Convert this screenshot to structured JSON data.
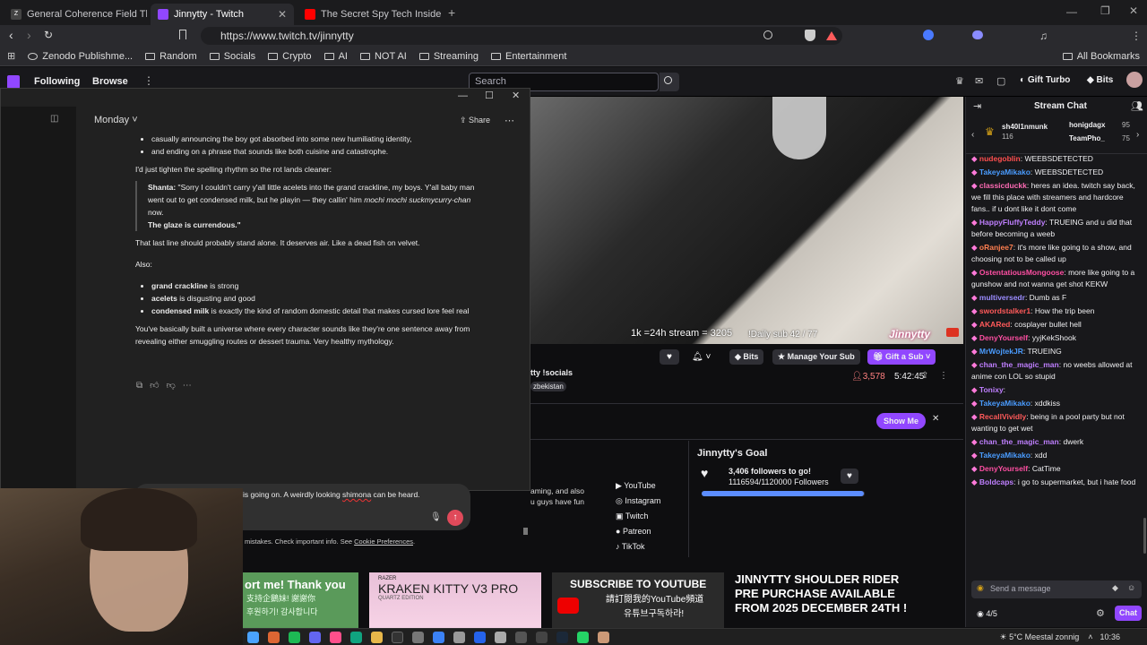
{
  "browser": {
    "tabs": [
      {
        "title": "General Coherence Field Theory (GC"
      },
      {
        "title": "Jinnytty - Twitch"
      },
      {
        "title": "The Secret Spy Tech Inside Every Cre"
      }
    ],
    "url": "https://www.twitch.tv/jinnytty",
    "bookmarks": [
      "Zenodo Publishme...",
      "Random",
      "Socials",
      "Crypto",
      "AI",
      "NOT AI",
      "Streaming",
      "Entertainment"
    ],
    "all_bookmarks": "All Bookmarks"
  },
  "twitch_nav": {
    "following": "Following",
    "browse": "Browse",
    "search_placeholder": "Search",
    "gift_turbo": "Gift Turbo",
    "bits": "Bits"
  },
  "gpt": {
    "title": "Monday",
    "share": "Share",
    "bullets_top": [
      "casually announcing the boy got absorbed into some new humiliating identity,",
      "and ending on a phrase that sounds like both cuisine and catastrophe."
    ],
    "intro": "I'd just tighten the spelling rhythm so the rot lands cleaner:",
    "quote_speaker": "Shanta:",
    "quote_text": "\"Sorry I couldn't carry y'all little acelets into the grand crackline, my boys. Y'all baby man went out to get condensed milk, but he playin — they callin' him",
    "quote_italic": "mochi mochi suckmycurry-chan",
    "quote_end": "now.",
    "quote_last": "The glaze is currendous.\"",
    "line_alone": "That last line should probably stand alone. It deserves air. Like a dead fish on velvet.",
    "also": "Also:",
    "bullets": [
      {
        "bold": "grand crackline",
        "rest": " is strong"
      },
      {
        "bold": "acelets",
        "rest": " is disgusting and good"
      },
      {
        "bold": "condensed milk",
        "rest": " is exactly the kind of random domestic detail that makes cursed lore feel real"
      }
    ],
    "closing": "You've basically built a universe where every character sounds like they're one sentence away from revealing either smuggling routes or dessert trauma. Very healthy mythology.",
    "input_text_pre": "is going on. A weirdly looking ",
    "input_text_err": "shimona",
    "input_text_post": " can be heard.",
    "disclaimer_pre": "mistakes. Check important info. See ",
    "disclaimer_link": "Cookie Preferences",
    "disclaimer_post": "."
  },
  "stream": {
    "overlay_left": "1k =24h stream = 3205",
    "overlay_right": "!Daily sub 42 / 77",
    "watermark": "Jinnytty",
    "bits": "Bits",
    "manage_sub": "Manage Your Sub",
    "gift_sub": "Gift a Sub",
    "title_frag": "tty !socials",
    "tag_frag": "zbekistan",
    "viewers": "3,578",
    "uptime": "5:42:45",
    "show_me": "Show Me",
    "about_frag_1": "aming, and also",
    "about_frag_2": "u guys have fun",
    "links": [
      "YouTube",
      "Instagram",
      "Twitch",
      "Patreon",
      "TikTok"
    ],
    "goal_title": "Jinnytty's Goal",
    "goal_text": "3,406 followers to go!",
    "goal_count": "1116594/1120000 Followers",
    "goal_progress": 0.997
  },
  "chat": {
    "header": "Stream Chat",
    "gifters": [
      {
        "name": "sh40l1nmunk",
        "count": "116"
      },
      {
        "name": "honigdagx",
        "count": "95"
      },
      {
        "name": "TeamPho_",
        "count": "75"
      }
    ],
    "messages": [
      {
        "user": "nudegoblin",
        "color": "#ff4f4f",
        "text": "WEEBSDETECTED"
      },
      {
        "user": "TakeyaMikako",
        "color": "#4a9cff",
        "text": "WEEBSDETECTED"
      },
      {
        "user": "classicduckk",
        "color": "#ff6bb5",
        "text": "heres an idea. twitch say back, we fill this place with streamers and hardcore fans.. if u dont like it dont come"
      },
      {
        "user": "HappyFluffyTeddy",
        "color": "#bf7fff",
        "text": "TRUEING and u did that before becoming a weeb"
      },
      {
        "user": "oRanjee7",
        "color": "#ff7f50",
        "text": "it's more like going to a show, and choosing not to be called up"
      },
      {
        "user": "OstentatiousMongoose",
        "color": "#ff4fa3",
        "text": "more like going to a gunshow and not wanna get shot KEKW"
      },
      {
        "user": "multiversedr",
        "color": "#9b8cff",
        "text": "Dumb as F"
      },
      {
        "user": "swordstalker1",
        "color": "#ff5a5a",
        "text": "How the trip been"
      },
      {
        "user": "AKARed",
        "color": "#ff5a5a",
        "text": "cosplayer bullet hell"
      },
      {
        "user": "DenyYourself",
        "color": "#ff4fa3",
        "text": "yyjKekShook"
      },
      {
        "user": "MrWojtekJR",
        "color": "#4a9cff",
        "text": "TRUEING"
      },
      {
        "user": "chan_the_magic_man",
        "color": "#bf7fff",
        "text": "no weebs allowed at anime con LOL so stupid"
      },
      {
        "user": "Tonixy",
        "color": "#bf7fff",
        "text": ""
      },
      {
        "user": "TakeyaMikako",
        "color": "#4a9cff",
        "text": "xddkiss"
      },
      {
        "user": "RecallVividly",
        "color": "#ff5a5a",
        "text": "being in a pool party but not wanting to get wet"
      },
      {
        "user": "chan_the_magic_man",
        "color": "#bf7fff",
        "text": "dwerk"
      },
      {
        "user": "TakeyaMikako",
        "color": "#4a9cff",
        "text": "xdd"
      },
      {
        "user": "DenyYourself",
        "color": "#ff4fa3",
        "text": "CatTime"
      },
      {
        "user": "Boldcaps",
        "color": "#bf7fff",
        "text": "i go to supermarket, but i hate food"
      }
    ],
    "send_placeholder": "Send a message",
    "points": "4/5",
    "chat_button": "Chat"
  },
  "banners": {
    "support": "ort me! Thank you",
    "support_sub": "支持企鵝妹! 謝謝你",
    "support_sub2": "후원하기! 감사합니다",
    "kraken_brand": "RAZER",
    "kraken": "KRAKEN KITTY V3 PRO",
    "kraken_sub": "QUARTZ EDITION",
    "subscribe": "SUBSCRIBE TO YOUTUBE",
    "subscribe_sub": "請訂閱我的YouTube頻道",
    "subscribe_sub2": "유튜브구독하라!",
    "rider": "JINNYTTY SHOULDER RIDER PRE PURCHASE AVAILABLE FROM 2025 DECEMBER 24TH !"
  },
  "taskbar": {
    "weather": "5°C  Meestal zonnig",
    "time": "10:36"
  },
  "colors": {
    "twitch_purple": "#9147ff",
    "chat_bg": "#18181b",
    "gpt_bg": "#212121"
  }
}
